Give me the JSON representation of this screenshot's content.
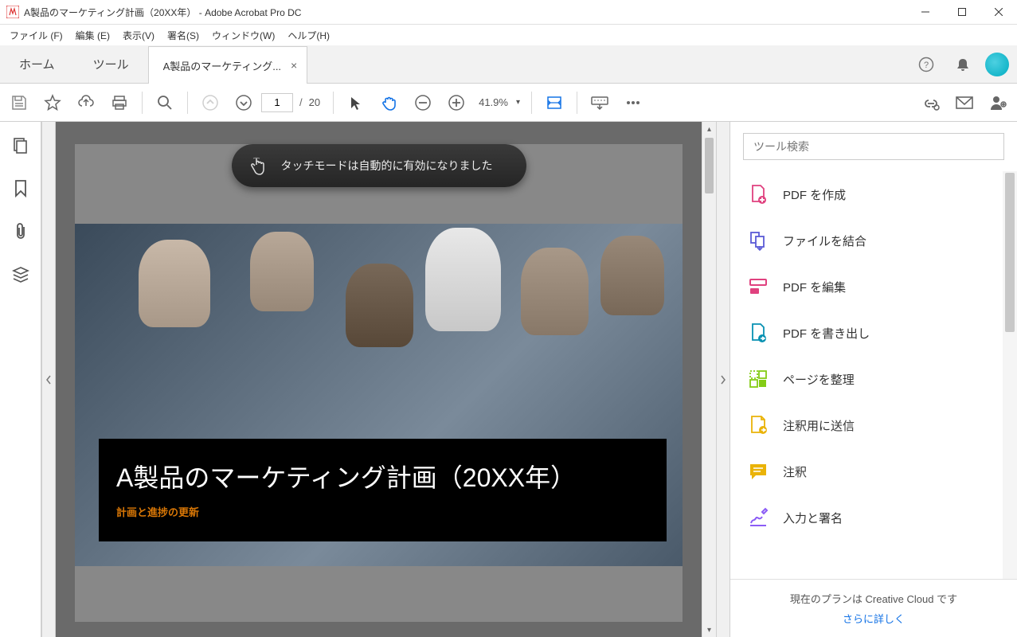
{
  "window": {
    "title": "A製品のマーケティング計画（20XX年） - Adobe Acrobat Pro DC"
  },
  "menu": [
    "ファイル (F)",
    "編集 (E)",
    "表示(V)",
    "署名(S)",
    "ウィンドウ(W)",
    "ヘルプ(H)"
  ],
  "tabs": {
    "home": "ホーム",
    "tools": "ツール",
    "doc_label": "A製品のマーケティング...",
    "close": "×"
  },
  "toolbar": {
    "page_current": "1",
    "page_sep": "/",
    "page_total": "20",
    "zoom": "41.9%"
  },
  "toast": "タッチモードは自動的に有効になりました",
  "document": {
    "title": "A製品のマーケティング計画（20XX年）",
    "subtitle": "計画と進捗の更新"
  },
  "right_panel": {
    "search_placeholder": "ツール検索",
    "tools": [
      "PDF を作成",
      "ファイルを結合",
      "PDF を編集",
      "PDF を書き出し",
      "ページを整理",
      "注釈用に送信",
      "注釈",
      "入力と署名"
    ],
    "footer": "現在のプランは Creative Cloud です",
    "footer_link": "さらに詳しく"
  }
}
